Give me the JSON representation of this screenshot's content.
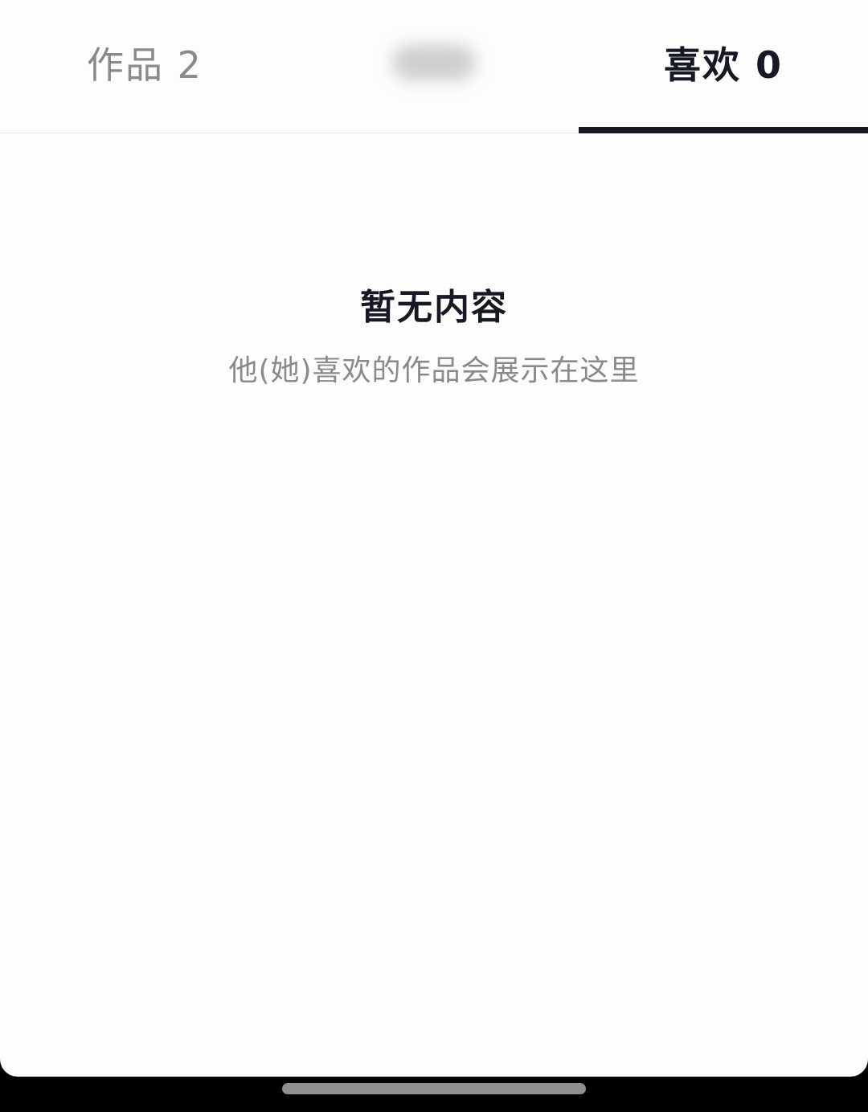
{
  "tabs": {
    "works_label": "作品 2",
    "likes_label": "喜欢 0",
    "active": "likes"
  },
  "empty_state": {
    "title": "暂无内容",
    "subtitle": "他(她)喜欢的作品会展示在这里"
  },
  "colors": {
    "active_text": "#161823",
    "inactive_text": "#8a8a8c",
    "background": "#fdfdfb"
  }
}
